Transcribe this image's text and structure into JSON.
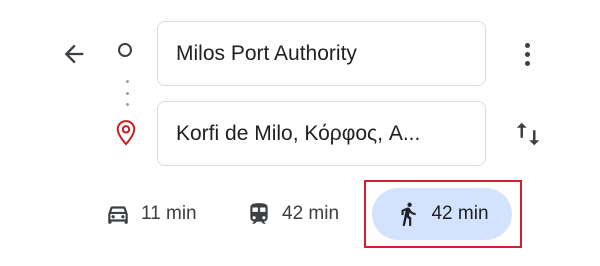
{
  "header": {
    "origin": {
      "value": "Milos Port Authority"
    },
    "destination": {
      "value": "Korfi de Milo, Κόρφος, A..."
    }
  },
  "icons": {
    "back": "arrow-back-icon",
    "origin": "origin-circle-icon",
    "destination": "location-pin-icon",
    "more": "more-vert-icon",
    "swap": "swap-vertical-icon",
    "drive": "car-icon",
    "transit": "train-icon",
    "walk": "walking-person-icon"
  },
  "modes": {
    "drive": {
      "label": "11 min"
    },
    "transit": {
      "label": "42 min"
    },
    "walk": {
      "label": "42 min",
      "selected": true
    }
  },
  "colors": {
    "selected_mode_bg": "#d3e3fd",
    "pin": "#c5221f",
    "annotation_box": "#d0202e"
  }
}
